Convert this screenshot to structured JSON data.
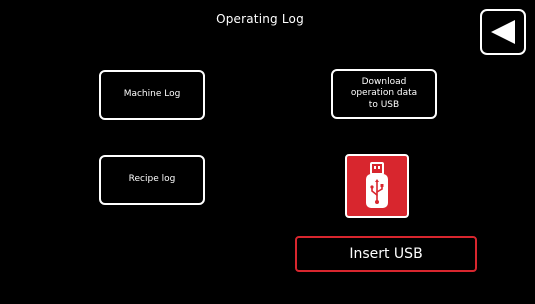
{
  "header": {
    "title": "Operating Log"
  },
  "buttons": {
    "machine_log": "Machine Log",
    "recipe_log": "Recipe log",
    "download": "Download\noperation data\nto USB"
  },
  "usb": {
    "status": "Insert USB",
    "icon": "usb-stick-icon",
    "accent_color": "#d8262e"
  },
  "navigation": {
    "back_icon": "back-triangle-icon"
  }
}
